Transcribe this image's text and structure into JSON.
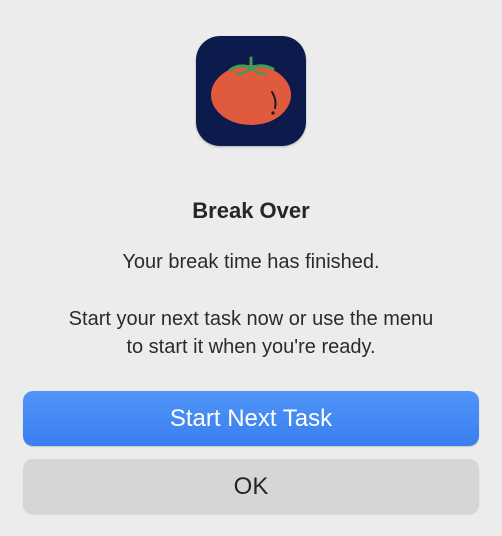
{
  "dialog": {
    "icon": "tomato-app-icon",
    "title": "Break Over",
    "message_primary": "Your break time has finished.",
    "message_secondary": "Start your next task now or use the menu\nto start it when you're ready."
  },
  "buttons": {
    "primary_label": "Start Next Task",
    "secondary_label": "OK"
  },
  "colors": {
    "background": "#ececec",
    "icon_background": "#0c1a4c",
    "tomato": "#e05a3d",
    "stem": "#3f9b57",
    "primary_button": "#3a7ff0",
    "secondary_button": "#d6d6d6"
  }
}
